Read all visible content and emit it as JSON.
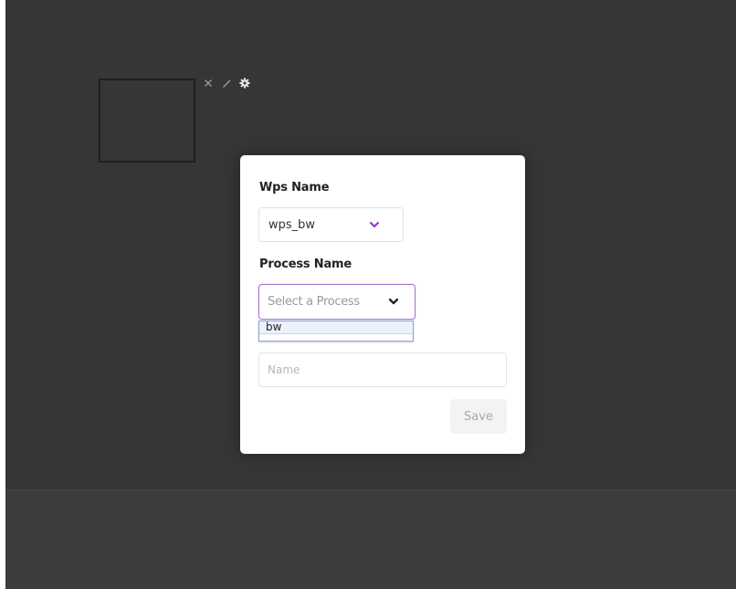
{
  "canvas": {
    "widget_tools": [
      {
        "icon": "close-icon",
        "glyph": "×"
      },
      {
        "icon": "pencil-icon"
      },
      {
        "icon": "gear-icon"
      }
    ]
  },
  "modal": {
    "wps": {
      "label": "Wps Name",
      "selected_value": "wps_bw"
    },
    "process": {
      "label": "Process Name",
      "placeholder": "Select a Process",
      "options": [
        "bw"
      ]
    },
    "name_field": {
      "value": "",
      "placeholder": "Name"
    },
    "save_label": "Save"
  },
  "colors": {
    "backdrop": "#363636",
    "accent": "#a374d4",
    "chevron_purple": "#8a3fd1"
  }
}
